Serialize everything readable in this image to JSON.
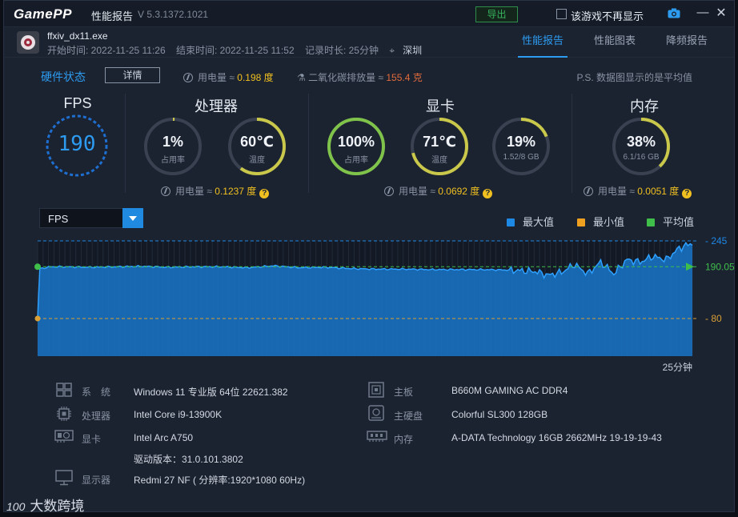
{
  "titlebar": {
    "logo_game": "Game",
    "logo_pp": "PP",
    "app_title": "性能报告",
    "version": "V 5.3.1372.1021",
    "export_label": "导出",
    "dont_show_label": "该游戏不再显示",
    "camera_icon": "camera-icon",
    "minimize_icon": "minimize-icon",
    "close_icon": "close-icon"
  },
  "process": {
    "name": "ffxiv_dx11.exe",
    "start": "开始时间: 2022-11-25 11:26",
    "end": "结束时间: 2022-11-25 11:52",
    "duration": "记录时长: 25分钟",
    "city": "深圳",
    "tabs": [
      "性能报告",
      "性能图表",
      "降频报告"
    ],
    "active_tab": 0
  },
  "hardware": {
    "title": "硬件状态",
    "detail_label": "详情",
    "power_label": "用电量 ≈",
    "power_value": "0.198 度",
    "co2_label": "二氧化碳排放量 ≈",
    "co2_value": "155.4 克",
    "note": "P.S. 数据图显示的是平均值"
  },
  "panels": {
    "fps": {
      "title": "FPS",
      "value": "190"
    },
    "cpu": {
      "title": "处理器",
      "usage": {
        "value": "1%",
        "label": "占用率",
        "fraction": 0.01
      },
      "temp": {
        "value": "60℃",
        "label": "温度",
        "fraction": 0.6
      },
      "power_label": "用电量 ≈",
      "power_value": "0.1237 度"
    },
    "gpu": {
      "title": "显卡",
      "usage": {
        "value": "100%",
        "label": "占用率",
        "fraction": 1.0
      },
      "temp": {
        "value": "71℃",
        "label": "温度",
        "fraction": 0.71
      },
      "vram": {
        "value": "19%",
        "label": "1.52/8 GB",
        "fraction": 0.19
      },
      "power_label": "用电量 ≈",
      "power_value": "0.0692 度"
    },
    "mem": {
      "title": "内存",
      "usage": {
        "value": "38%",
        "label": "6.1/16 GB",
        "fraction": 0.38
      },
      "power_label": "用电量 ≈",
      "power_value": "0.0051 度"
    }
  },
  "chart_controls": {
    "selected_metric": "FPS",
    "legend": [
      {
        "name": "最大值",
        "color": "#1e88e5"
      },
      {
        "name": "最小值",
        "color": "#f0a020"
      },
      {
        "name": "平均值",
        "color": "#3fbf4a"
      }
    ]
  },
  "chart_data": {
    "type": "area",
    "series_name": "FPS",
    "xlabel": "25分钟",
    "ylim": [
      0,
      245
    ],
    "max": 245,
    "avg": 190.05,
    "min": 80,
    "max_label": "245",
    "avg_label": "190.05",
    "min_label": "80",
    "x_minutes": [
      0,
      0.5,
      1,
      2,
      3,
      4,
      5,
      6,
      7,
      8,
      9,
      10,
      11,
      12,
      13,
      14,
      15,
      16,
      17,
      18,
      19,
      19.5,
      20,
      20.5,
      21,
      21.5,
      22,
      22.5,
      23,
      23.5,
      24,
      24.5,
      25
    ],
    "values": [
      185,
      190,
      190,
      189,
      190,
      191,
      189,
      190,
      190,
      188,
      192,
      188,
      189,
      186,
      185,
      185,
      184,
      184,
      184,
      183,
      180,
      172,
      178,
      195,
      175,
      200,
      175,
      205,
      200,
      212,
      205,
      230,
      240
    ]
  },
  "system": {
    "os_label": "系　统",
    "os_value": "Windows 11 专业版 64位 22621.382",
    "cpu_label": "处理器",
    "cpu_value": "Intel Core i9-13900K",
    "gpu_label": "显卡",
    "gpu_value": "Intel Arc A750",
    "driver_value": "驱动版本：31.0.101.3802",
    "display_label": "显示器",
    "display_value": "Redmi 27 NF ( 分辨率:1920*1080 60Hz)",
    "board_label": "主板",
    "board_value": "B660M GAMING AC DDR4",
    "disk_label": "主硬盘",
    "disk_value": "Colorful SL300 128GB",
    "mem_label": "内存",
    "mem_value": "A-DATA Technology 16GB 2662MHz 19-19-19-43"
  },
  "watermark": {
    "logo": "100",
    "text": "大数跨境"
  }
}
